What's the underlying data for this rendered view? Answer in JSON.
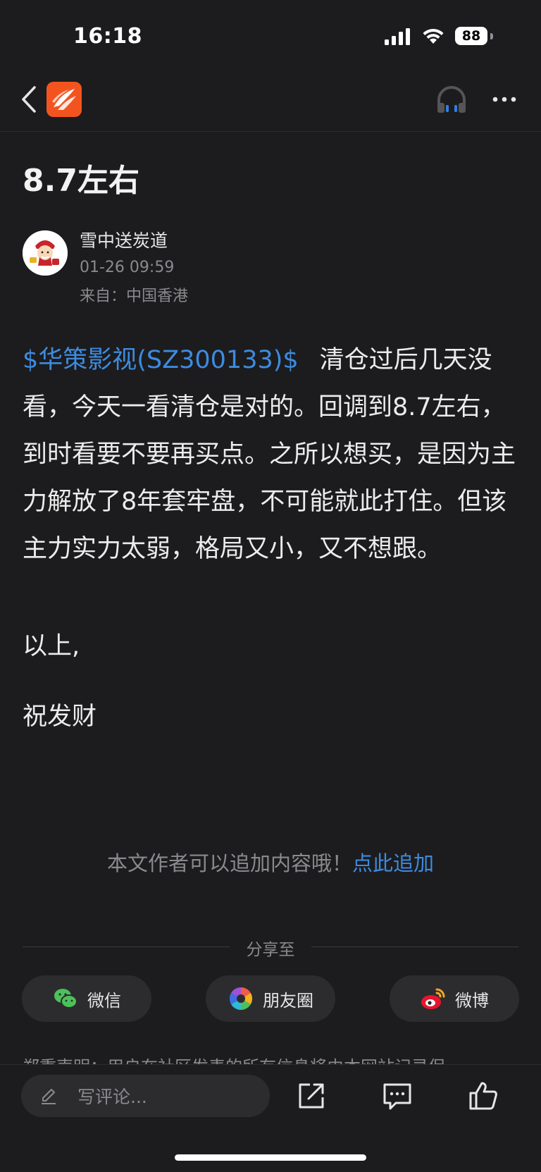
{
  "status_bar": {
    "time": "16:18",
    "battery": "88"
  },
  "nav": {
    "back_icon": "chevron-left-icon",
    "logo_icon": "app-logo-icon",
    "listen_icon": "headphone-icon",
    "more_icon": "more-dots-icon"
  },
  "article": {
    "title": "8.7左右",
    "author": "雪中送炭道",
    "time": "01-26 09:59",
    "location": "来自：中国香港",
    "stock_link": "$华策影视(SZ300133)$",
    "body": "清仓过后几天没看，今天一看清仓是对的。回调到8.7左右，到时看要不要再买点。之所以想买，是因为主力解放了8年套牢盘，不可能就此打住。但该主力实力太弱，格局又小，又不想跟。",
    "para2": "以上,",
    "para3": "祝发财"
  },
  "append": {
    "note": "本文作者可以追加内容哦！",
    "link": "点此追加"
  },
  "share": {
    "label": "分享至",
    "buttons": [
      {
        "label": "微信",
        "icon": "wechat-icon"
      },
      {
        "label": "朋友圈",
        "icon": "moments-icon"
      },
      {
        "label": "微博",
        "icon": "weibo-icon"
      }
    ]
  },
  "disclaimer": "郑重声明：用户在社区发表的所有信息将由本网站记录保",
  "bottom_bar": {
    "comment_placeholder": "写评论...",
    "icons": [
      "share-out-icon",
      "comment-icon",
      "like-icon"
    ]
  },
  "colors": {
    "background": "#1c1c1e",
    "link": "#3d8be0",
    "logo": "#f3541f",
    "muted": "#8a8a8e"
  }
}
